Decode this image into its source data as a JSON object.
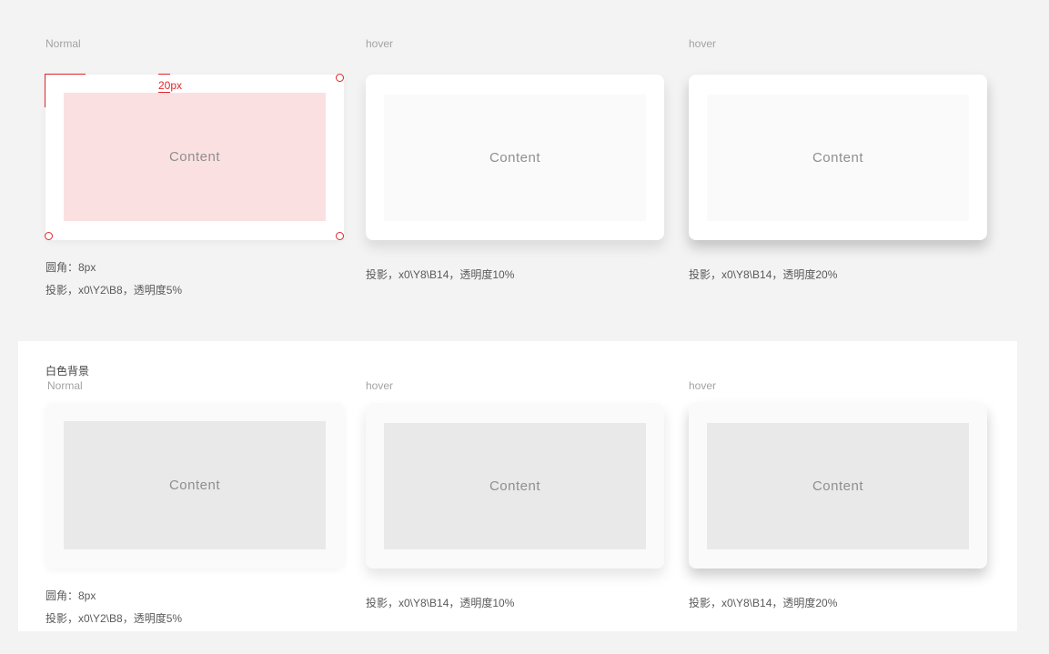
{
  "top_row": {
    "labels": [
      "Normal",
      "hover",
      "hover"
    ],
    "content_label": "Content",
    "measure_label": "20px",
    "specs": {
      "normal_radius": "圆角：8px",
      "normal_shadow": "投影，x0\\Y2\\B8，透明度5%",
      "hover1_shadow": "投影，x0\\Y8\\B14，透明度10%",
      "hover2_shadow": "投影，x0\\Y8\\B14，透明度20%"
    }
  },
  "white_section": {
    "title": "白色背景",
    "labels": [
      "Normal",
      "hover",
      "hover"
    ],
    "content_label": "Content",
    "specs": {
      "normal_radius": "圆角：8px",
      "normal_shadow": "投影，x0\\Y2\\B8，透明度5%",
      "hover1_shadow": "投影，x0\\Y8\\B14，透明度10%",
      "hover2_shadow": "投影，x0\\Y8\\B14，透明度20%"
    }
  },
  "colors": {
    "page_bg": "#f3f3f3",
    "accent_red": "#e0262b",
    "pink_fill": "#fbe0e1",
    "gray_fill": "#e9e9e9"
  }
}
